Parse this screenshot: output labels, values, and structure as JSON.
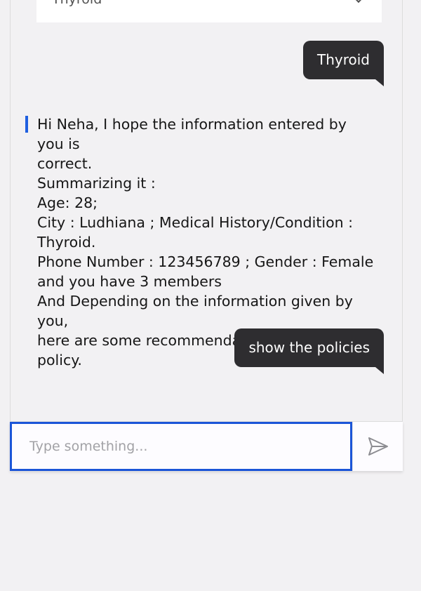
{
  "dropdown": {
    "selected_value": "Thyroid"
  },
  "messages": {
    "user_1": "Thyroid",
    "bot_1": {
      "lines": [
        "Hi Neha, I hope the information entered by you is",
        "correct.",
        "Summarizing it :",
        "Age: 28;",
        "City : Ludhiana ; Medical History/Condition :",
        "Thyroid.",
        "Phone Number : 123456789 ; Gender : Female",
        "and you have 3 members",
        "And Depending on the information given by you,",
        "here are some recommendations for the policy."
      ]
    },
    "user_2": "show the policies"
  },
  "input": {
    "value": "",
    "placeholder": "Type something..."
  },
  "colors": {
    "accent": "#1b55d8",
    "user_bubble": "#2e2d30",
    "background": "#f2f1f3"
  },
  "icons": {
    "send": "send-icon",
    "dropdown": "chevron-down-icon"
  }
}
